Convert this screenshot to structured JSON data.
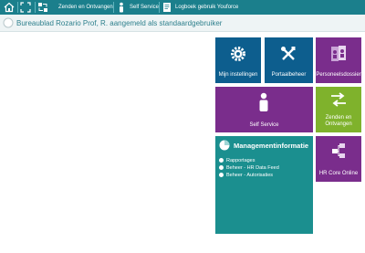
{
  "toolbar": {
    "items": [
      {
        "label": "",
        "icon": "home-icon"
      },
      {
        "label": "",
        "icon": "expand-icon"
      },
      {
        "label": "Zenden en Ontvangen",
        "icon": "send-receive-icon"
      },
      {
        "label": "Self Service",
        "icon": "person-icon"
      },
      {
        "label": "Logboek gebruik Youforce",
        "icon": "logbook-icon"
      }
    ]
  },
  "header": {
    "title": "Bureaublad  Rozario Prof, R. aangemeld als standaardgebruiker"
  },
  "tiles": {
    "mijn_instellingen": "Mijn instellingen",
    "portaalbeheer": "Portaalbeheer",
    "personeelsdossier": "Personeelsdossier",
    "self_service": "Self Service",
    "zenden_ontvangen_1": "Zenden en",
    "zenden_ontvangen_2": "Ontvangen",
    "hr_core_online": "HR Core Online"
  },
  "managementinformatie": {
    "title": "Managementinformatie",
    "items": [
      "Rapportages",
      "Beheer - HR Data Feed",
      "Beheer - Autorisaties"
    ]
  },
  "colors": {
    "toolbar": "#1b7f8c",
    "blue_tile": "#0d5e8e",
    "purple_tile": "#7a2d8c",
    "green_tile": "#7fb22c",
    "teal_tile": "#1b8f8f"
  }
}
